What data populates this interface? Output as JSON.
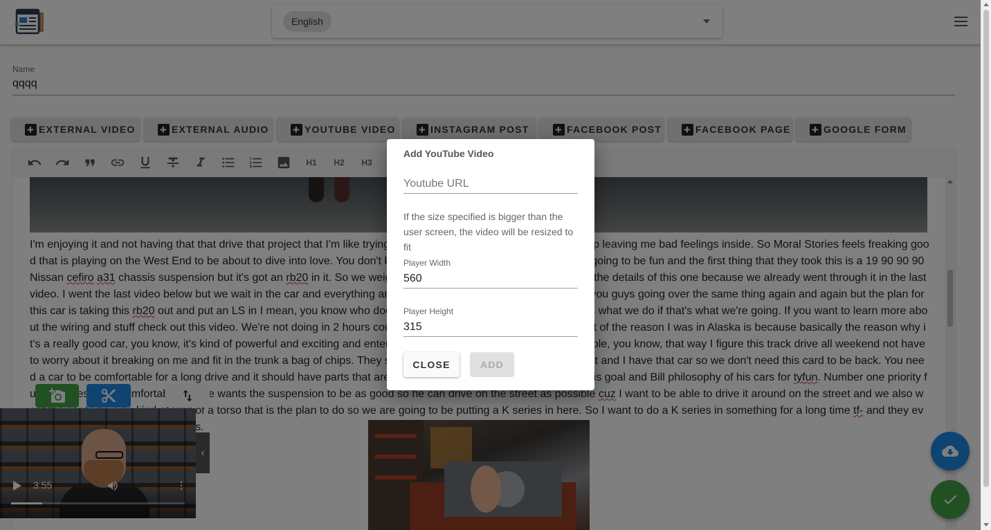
{
  "header": {
    "language": "English",
    "icons": {
      "logo": "newspaper-app-icon",
      "dropdown": "chevron-down-icon",
      "menu": "hamburger-menu-icon"
    }
  },
  "name_field": {
    "label": "Name",
    "value": "qqqq"
  },
  "embed_buttons": [
    {
      "label": "EXTERNAL VIDEO"
    },
    {
      "label": "EXTERNAL AUDIO"
    },
    {
      "label": "YOUTUBE VIDEO"
    },
    {
      "label": "INSTAGRAM POST"
    },
    {
      "label": "FACEBOOK POST"
    },
    {
      "label": "FACEBOOK PAGE"
    },
    {
      "label": "GOOGLE FORM"
    }
  ],
  "toolbar": {
    "tools": [
      "undo-icon",
      "redo-icon",
      "quote-icon",
      "link-icon",
      "underline-icon",
      "strikethrough-icon",
      "italic-icon",
      "bullet-list-icon",
      "numbered-list-icon",
      "image-icon"
    ],
    "headings": [
      "H1",
      "H2",
      "H3"
    ]
  },
  "article": {
    "lines": [
      "I'm enjoying it and not having that that drive that project that I'm like trying to do this weekend it's not going to end up leaving me bad feelings inside. So Moral Stories feels freaking good that is playing",
      "on the West End to be about to dive into love. You don't know he's overdoing it at this point but it's going to be fun and the first thing that they took this is a 19 90 90 90 Nissan ",
      "cefiro",
      " ",
      "a31",
      " chassis suspensi",
      "on but it's got an ",
      "rb20",
      " in it. So we weighed this car at the honestly, I'll spare you the details of this one because we already went through it in the last video. I went the last video below but we wait in the car and ever",
      "ything and talk more about that stuff. Don't bother you guys going over the same thing again and again but the plan for this car is taking this ",
      "rb20",
      " out and put an LS in I mean, you know who doesn't wh",
      "ile I was in LS swap. I mean, that's what we do if that's what we're going. If you want to learn more about the wiring and stuff check out this video. We're not doing in 2 hours course right now and we",
      " want to go to me out of the reason I was in Alaska is because basically the reason why it's a really good car, you know, it's kind of powerful and exciting and entertaining and whatever but while bein",
      "g reliable, you know, that way I figure this track drive all weekend not have to worry about it breaking on me and fit in the trunk a bag of chips. They say it's been a really really good car for that and I h",
      "ave that car so we don't need this card to be back. You need a car to be comfortable for a long drive and it should have parts that are super reliable are in route to work on it this goal and Bill philosophy",
      " of his cars for ",
      "tyfun",
      ". Number one priority fun and likes to be comfortable and he wants the suspension to be as good so he can drive on the street as possible ",
      "cuz",
      " I want to be able to drive it around",
      " on the street and we also want the car to be a lie kind of kind of a torso that is the plan to do so we are going to be putting a K series in here. So I want to do a K series in something for a long time ",
      "tf-",
      " and they even make a swap kit for this chassis."
    ]
  },
  "video_player": {
    "time": "3:55",
    "progress": 0.18
  },
  "dialog": {
    "title": "Add YouTube Video",
    "url_placeholder": "Youtube URL",
    "url_value": "",
    "note": "If the size specified is bigger than the user screen, the video will be resized to fit",
    "width_label": "Player Width",
    "width_value": "560",
    "height_label": "Player Height",
    "height_value": "315",
    "close_label": "CLOSE",
    "add_label": "ADD"
  }
}
